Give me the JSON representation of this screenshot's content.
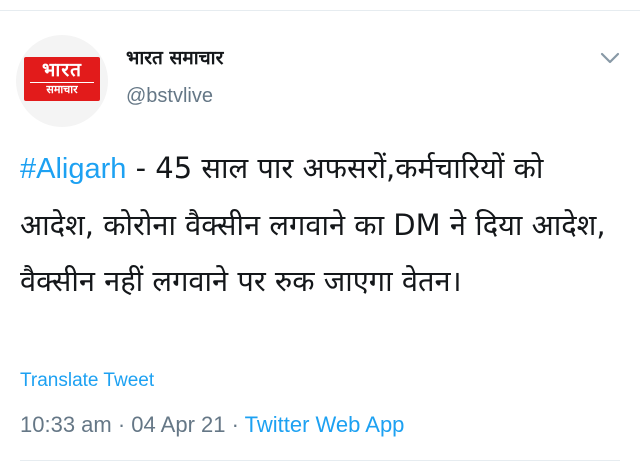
{
  "account": {
    "display_name": "भारत समाचार",
    "handle": "@bstvlive",
    "logo_line1": "भारत",
    "logo_line2": "समाचार"
  },
  "tweet": {
    "hashtag": "#Aligarh",
    "text": " - 45 साल पार अफसरों,कर्मचारियों को आदेश, कोरोना वैक्सीन लगवाने का DM ने दिया आदेश, वैक्सीन नहीं लगवाने पर रुक जाएगा वेतन।",
    "translate_label": "Translate Tweet",
    "time": "10:33 am",
    "date": "04 Apr 21",
    "separator": " · ",
    "source": "Twitter Web App"
  },
  "icons": {
    "menu": "chevron-down-icon"
  },
  "colors": {
    "link": "#1da1f2",
    "secondary_text": "#657786",
    "logo_red": "#e21b1b",
    "text": "#14171a"
  }
}
